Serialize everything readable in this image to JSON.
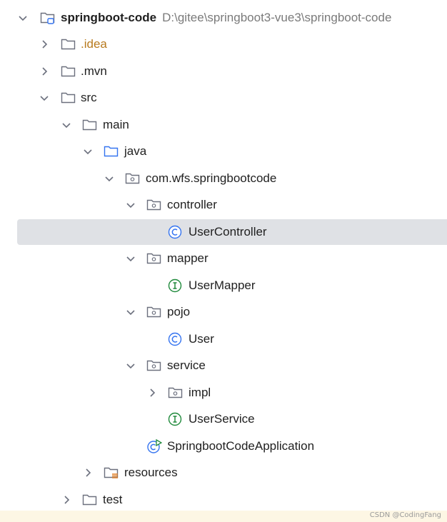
{
  "project": {
    "name": "springboot-code",
    "path": "D:\\gitee\\springboot3-vue3\\springboot-code"
  },
  "tree": {
    "idea": ".idea",
    "mvn": ".mvn",
    "src": "src",
    "main": "main",
    "java": "java",
    "package": "com.wfs.springbootcode",
    "controller": "controller",
    "user_controller": "UserController",
    "mapper": "mapper",
    "user_mapper": "UserMapper",
    "pojo": "pojo",
    "user": "User",
    "service": "service",
    "impl": "impl",
    "user_service": "UserService",
    "application": "SpringbootCodeApplication",
    "resources": "resources",
    "test": "test"
  },
  "watermark": "CSDN @CodingFang",
  "colors": {
    "selection": "#dfe1e5",
    "class_icon": "#3574f0",
    "interface_icon": "#208a3c",
    "folder_stroke": "#6c707e",
    "java_folder": "#3574f0",
    "idea_text": "#b87a1e"
  },
  "icons": {
    "expanded": "chevron-down-icon",
    "collapsed": "chevron-right-icon",
    "folder": "folder-icon",
    "package": "package-icon",
    "class": "class-icon",
    "interface": "interface-icon",
    "spring_app": "spring-boot-app-icon",
    "resources": "resources-folder-icon",
    "module": "module-icon"
  }
}
